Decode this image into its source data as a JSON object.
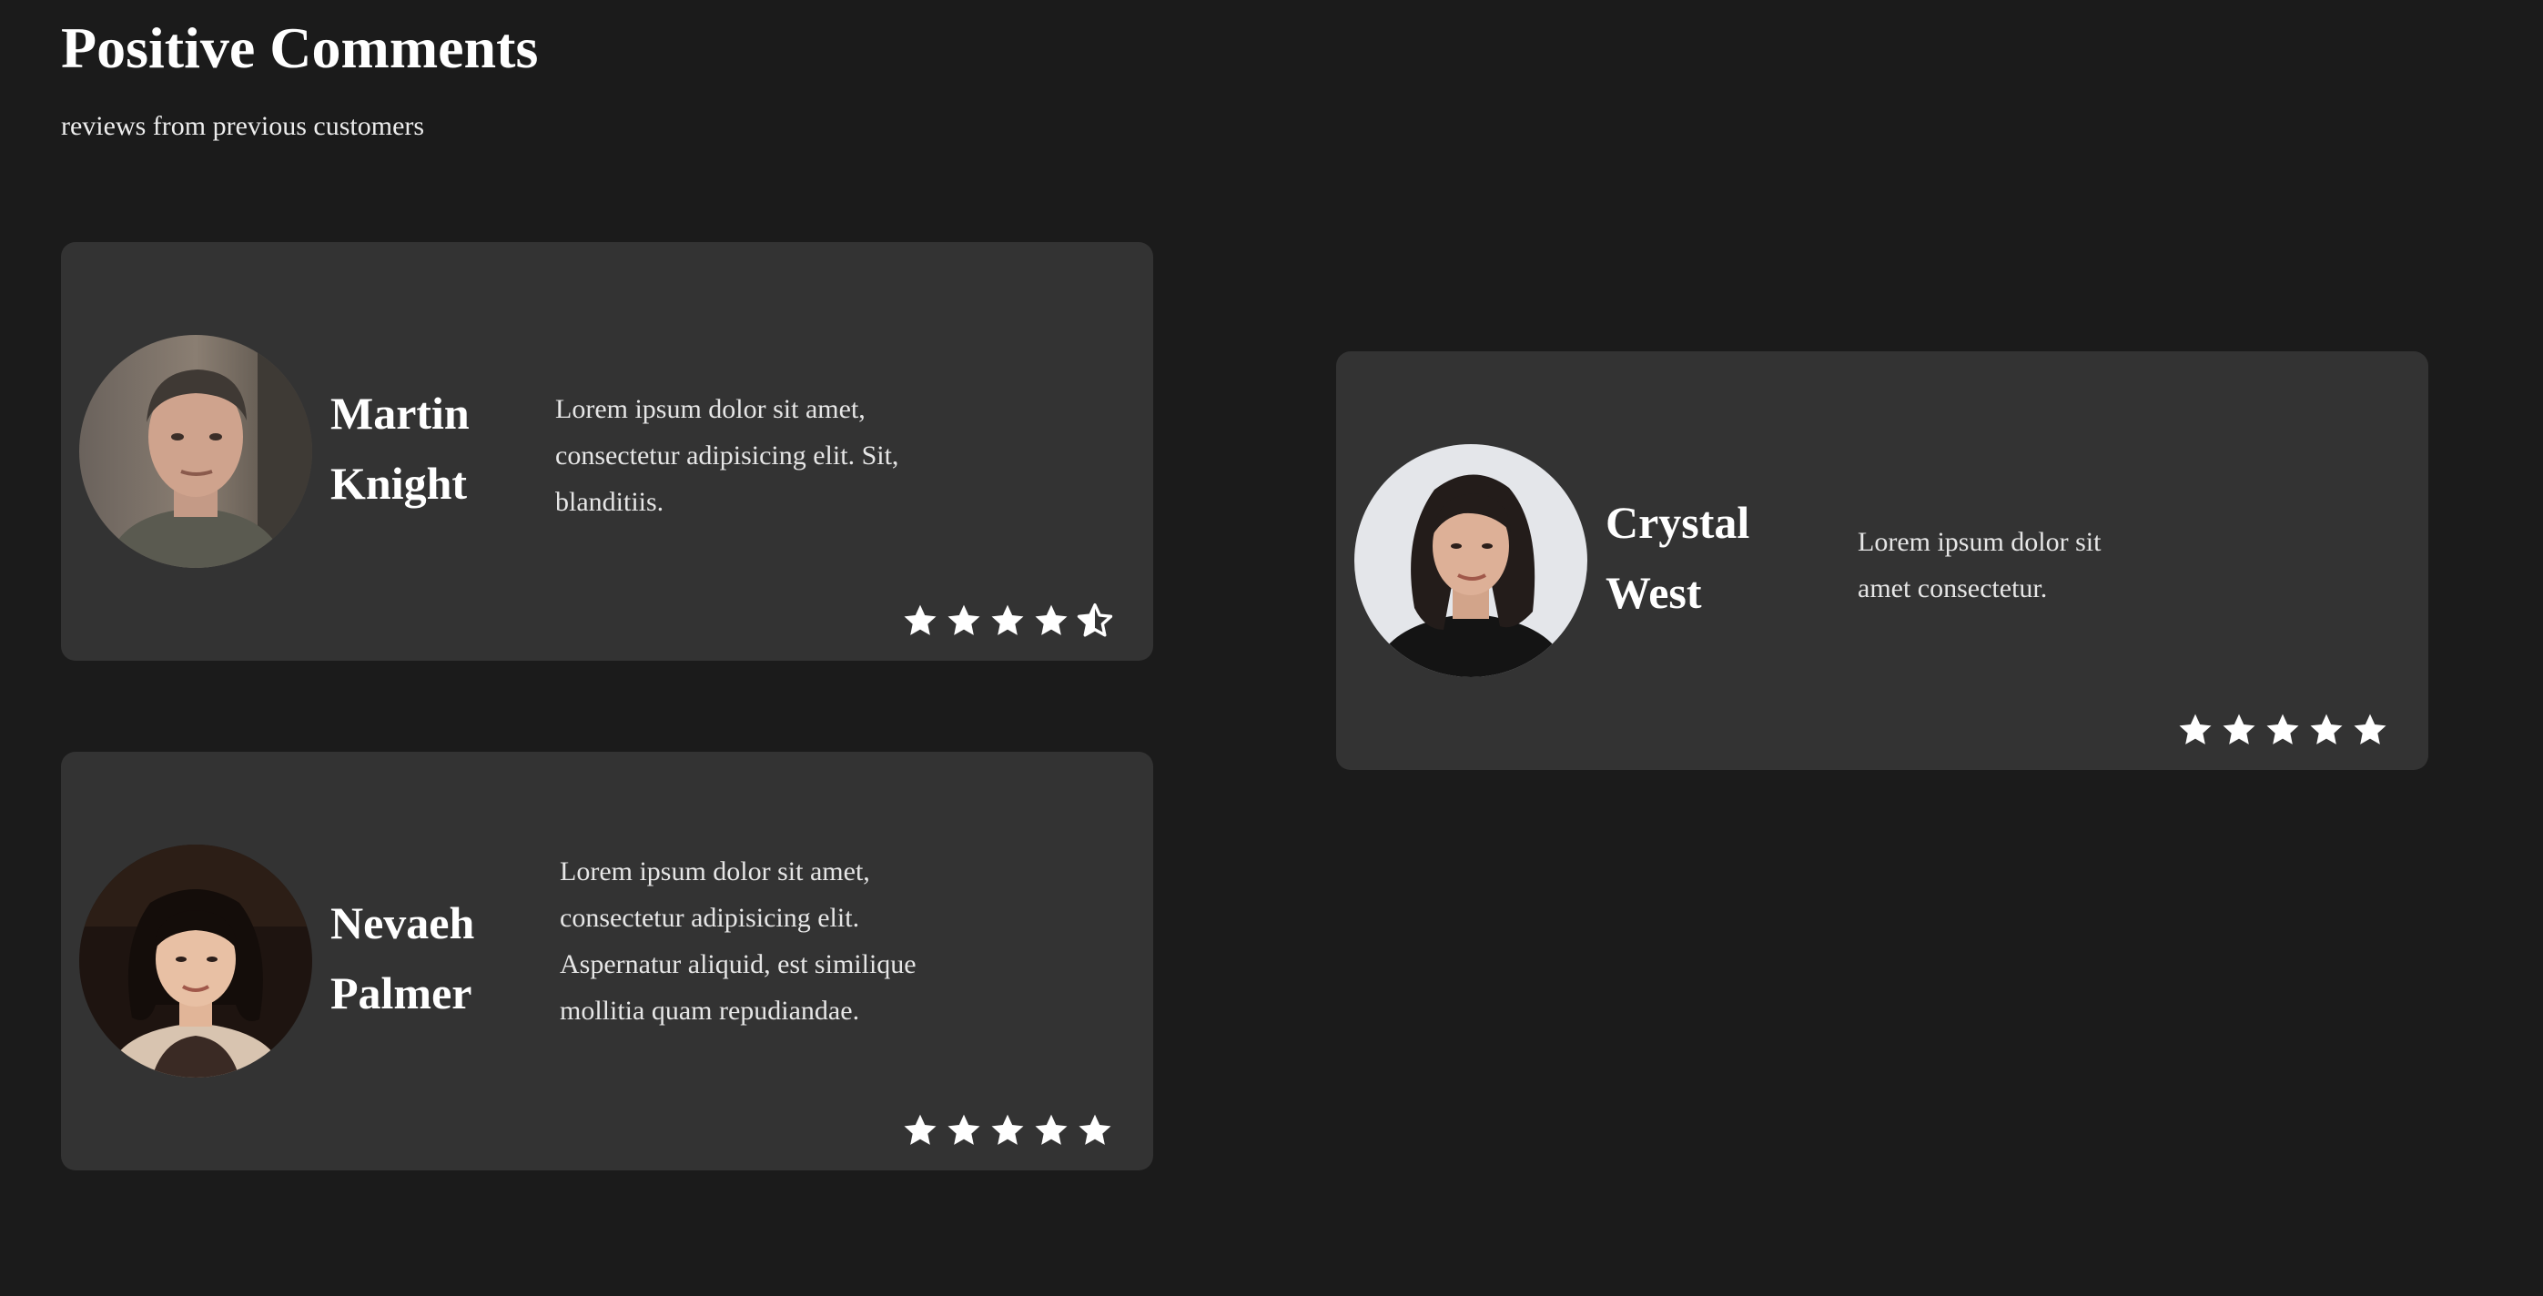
{
  "page": {
    "title": "Positive Comments",
    "subtitle": "reviews from previous customers"
  },
  "reviews": [
    {
      "name_line1": "Martin",
      "name_line2": "Knight",
      "text": "Lorem ipsum dolor sit amet, consectetur adipisicing elit. Sit, blanditiis.",
      "rating": 4.5
    },
    {
      "name_line1": "Crystal",
      "name_line2": "West",
      "text": "Lorem ipsum dolor sit amet consectetur.",
      "rating": 5
    },
    {
      "name_line1": "Nevaeh",
      "name_line2": "Palmer",
      "text": "Lorem ipsum dolor sit amet, consectetur adipisicing elit. Aspernatur aliquid, est similique mollitia quam repudiandae.",
      "rating": 5
    }
  ],
  "colors": {
    "background": "#1b1b1b",
    "card": "#333333",
    "star": "#ffffff"
  },
  "icons": {
    "star_full": "star-icon",
    "star_half": "star-half-icon"
  }
}
